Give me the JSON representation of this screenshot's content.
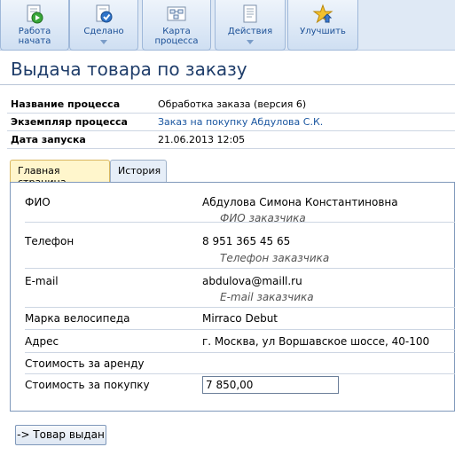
{
  "toolbar": {
    "buttons": [
      {
        "label": "Работа\nначата",
        "icon": "play-document-icon"
      },
      {
        "label": "Сделано",
        "icon": "check-document-icon"
      },
      {
        "label": "Карта\nпроцесса",
        "icon": "process-map-icon"
      },
      {
        "label": "Действия",
        "icon": "actions-document-icon"
      },
      {
        "label": "Улучшить",
        "icon": "improve-star-icon"
      }
    ]
  },
  "page": {
    "title": "Выдача товара по заказу"
  },
  "info": {
    "process_name_label": "Название процесса",
    "process_name_value": "Обработка заказа (версия 6)",
    "instance_label": "Экземпляр процесса",
    "instance_value": "Заказ на покупку Абдулова С.К.",
    "start_date_label": "Дата запуска",
    "start_date_value": "21.06.2013 12:05"
  },
  "tabs": [
    {
      "label": "Главная страница",
      "active": true
    },
    {
      "label": "История",
      "active": false
    }
  ],
  "form": {
    "fio_label": "ФИО",
    "fio_value": "Абдулова Симона Константиновна",
    "fio_hint": "ФИО заказчика",
    "phone_label": "Телефон",
    "phone_value": "8 951 365 45 65",
    "phone_hint": "Телефон заказчика",
    "email_label": "E-mail",
    "email_value": "abdulova@maill.ru",
    "email_hint": "E-mail заказчика",
    "bike_label": "Марка велосипеда",
    "bike_value": "Mirraco Debut",
    "address_label": "Адрес",
    "address_value": "г. Москва, ул Воршавское шоссе, 40-100",
    "rent_label": "Стоимость за аренду",
    "purchase_label": "Стоимость за покупку",
    "purchase_value": "7 850,00"
  },
  "actions": {
    "done_label": "-> Товар выдан"
  },
  "colors": {
    "title": "#1f3d6a",
    "link": "#1a56a0",
    "toolbar_text": "#1a4f96",
    "active_tab": "#fff6cc"
  }
}
